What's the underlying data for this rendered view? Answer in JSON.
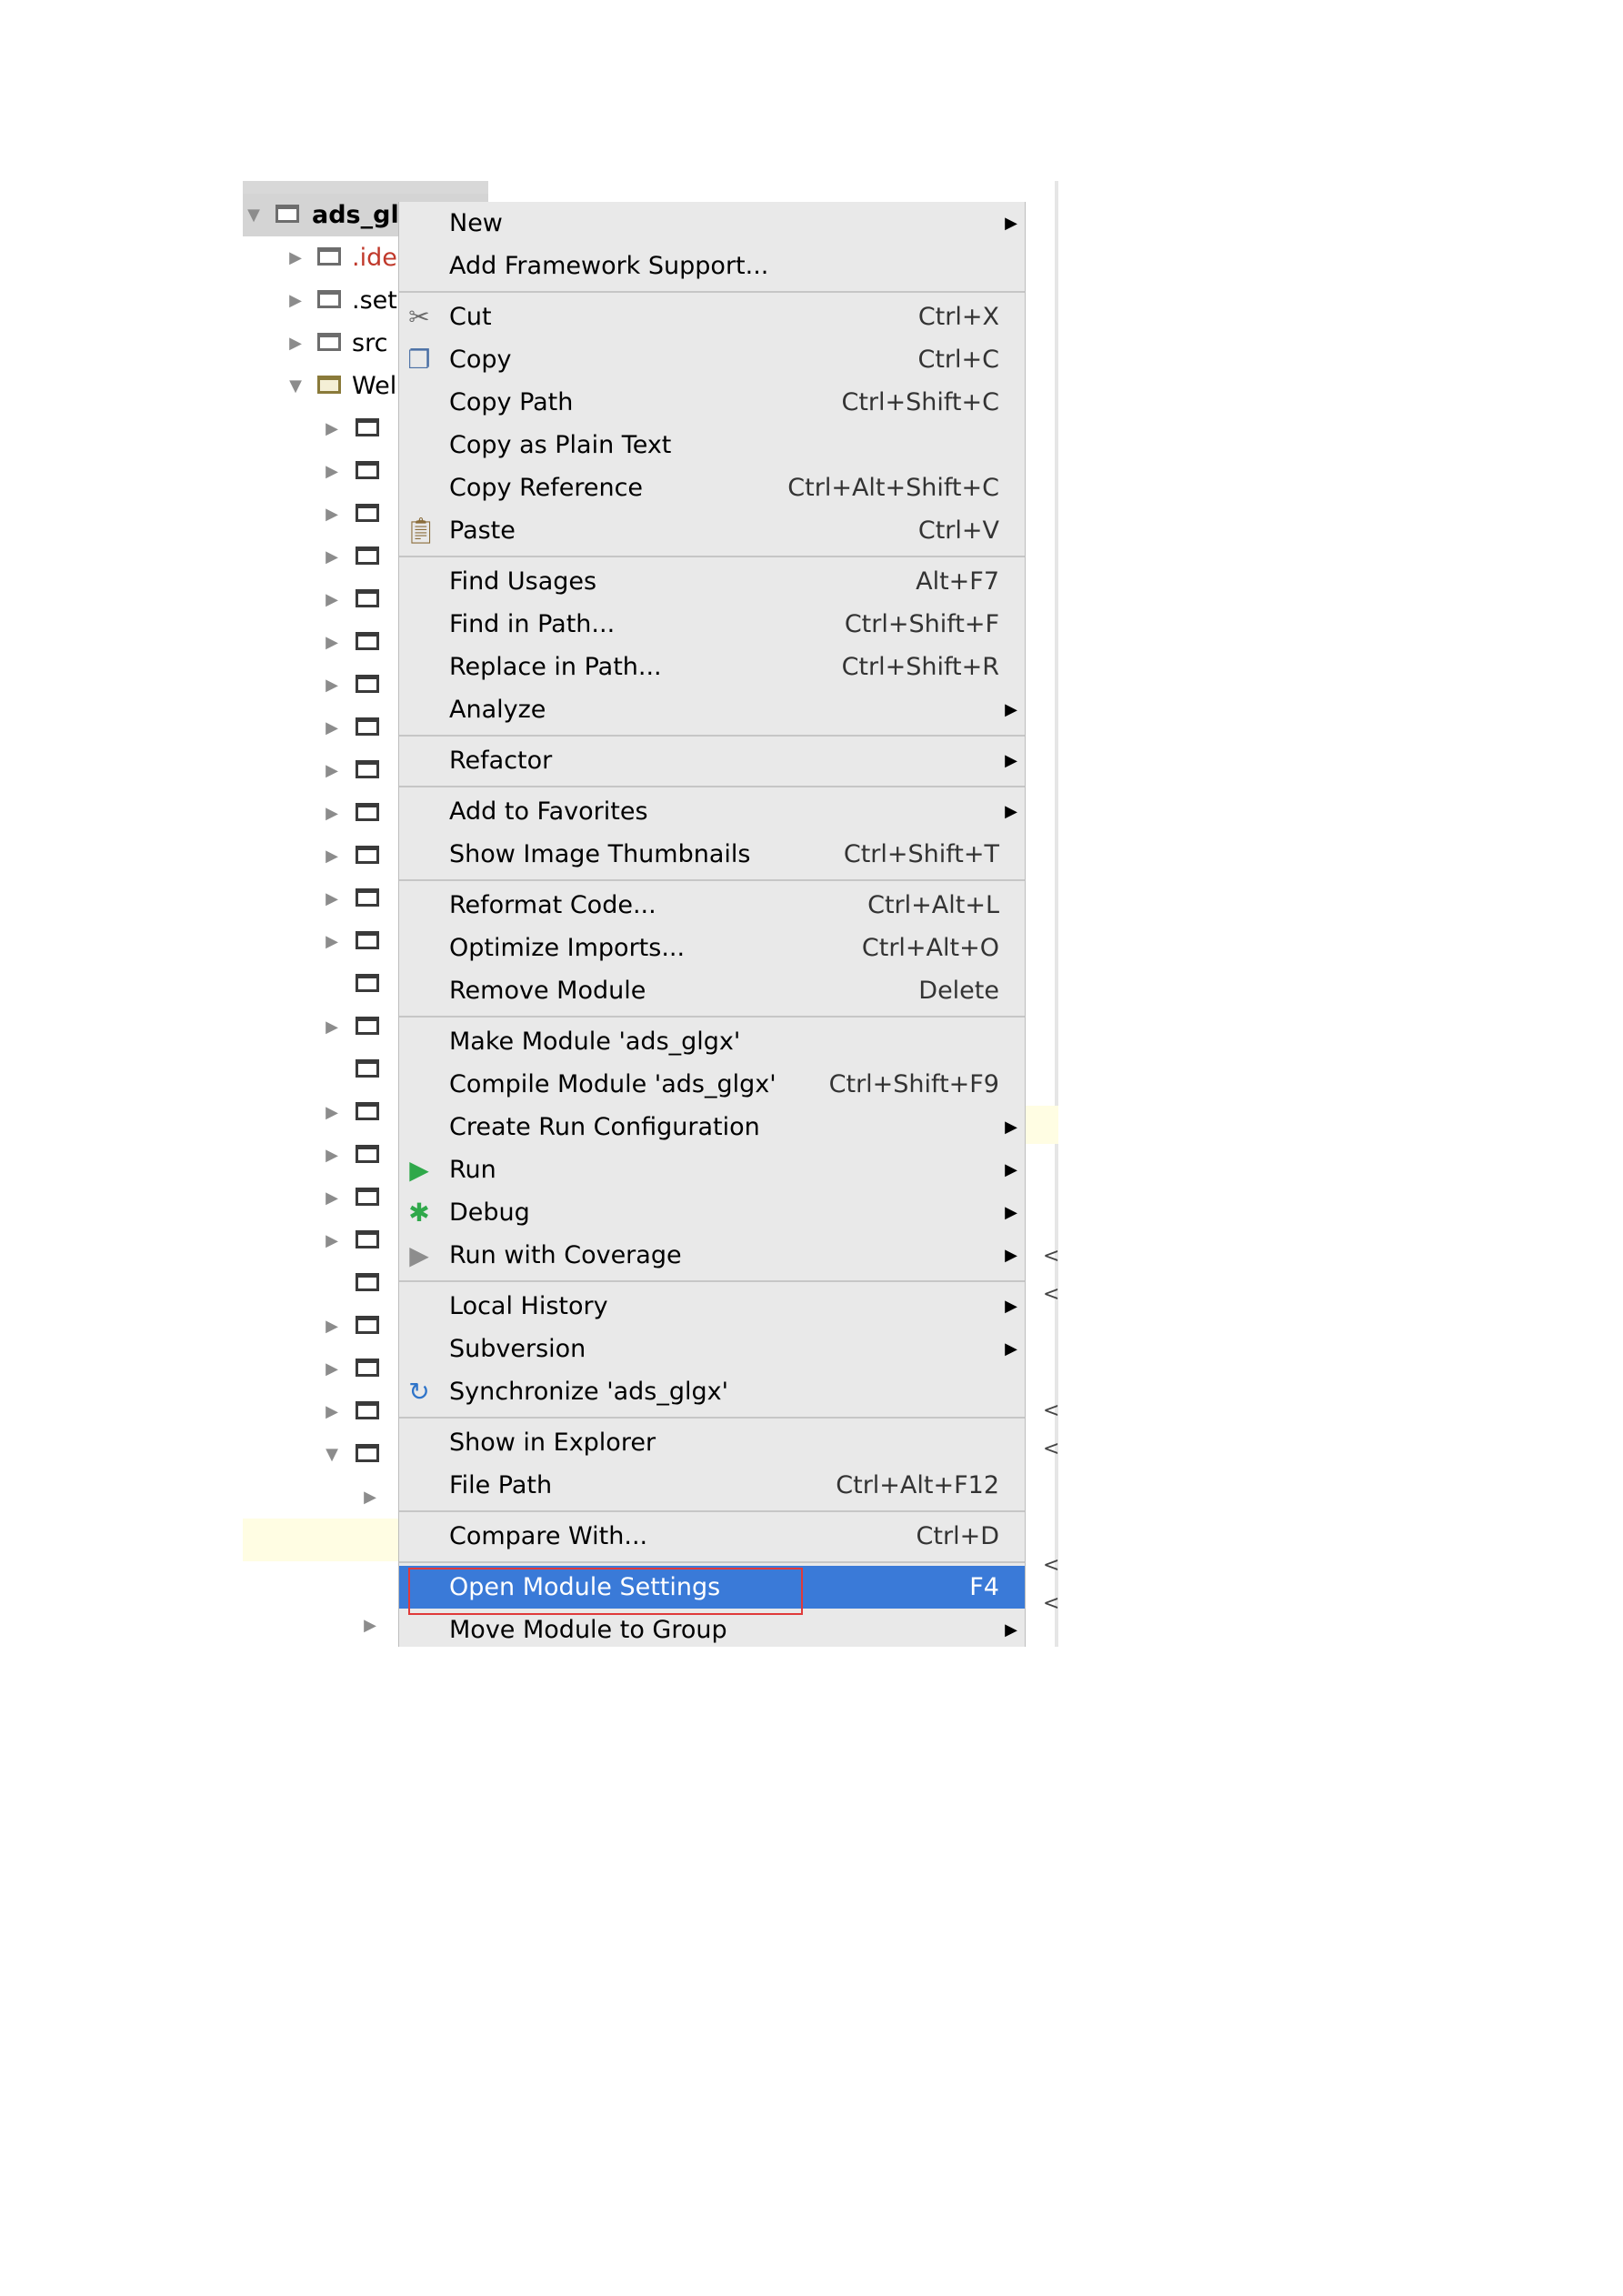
{
  "tree": {
    "root_label": "ads_gl",
    "rows": [
      {
        "label": ".ide",
        "style": "red"
      },
      {
        "label": ".set",
        "style": ""
      },
      {
        "label": "src",
        "style": ""
      },
      {
        "label": "Wel",
        "style": ""
      }
    ]
  },
  "menu": {
    "groups": [
      [
        {
          "label": "New",
          "shortcut": "",
          "submenu": true,
          "icon": ""
        },
        {
          "label": "Add Framework Support...",
          "shortcut": "",
          "submenu": false,
          "icon": ""
        }
      ],
      [
        {
          "label": "Cut",
          "shortcut": "Ctrl+X",
          "submenu": false,
          "icon": "scissors-icon"
        },
        {
          "label": "Copy",
          "shortcut": "Ctrl+C",
          "submenu": false,
          "icon": "copy-icon"
        },
        {
          "label": "Copy Path",
          "shortcut": "Ctrl+Shift+C",
          "submenu": false,
          "icon": ""
        },
        {
          "label": "Copy as Plain Text",
          "shortcut": "",
          "submenu": false,
          "icon": ""
        },
        {
          "label": "Copy Reference",
          "shortcut": "Ctrl+Alt+Shift+C",
          "submenu": false,
          "icon": ""
        },
        {
          "label": "Paste",
          "shortcut": "Ctrl+V",
          "submenu": false,
          "icon": "paste-icon"
        }
      ],
      [
        {
          "label": "Find Usages",
          "shortcut": "Alt+F7",
          "submenu": false,
          "icon": ""
        },
        {
          "label": "Find in Path...",
          "shortcut": "Ctrl+Shift+F",
          "submenu": false,
          "icon": ""
        },
        {
          "label": "Replace in Path...",
          "shortcut": "Ctrl+Shift+R",
          "submenu": false,
          "icon": ""
        },
        {
          "label": "Analyze",
          "shortcut": "",
          "submenu": true,
          "icon": ""
        }
      ],
      [
        {
          "label": "Refactor",
          "shortcut": "",
          "submenu": true,
          "icon": ""
        }
      ],
      [
        {
          "label": "Add to Favorites",
          "shortcut": "",
          "submenu": true,
          "icon": ""
        },
        {
          "label": "Show Image Thumbnails",
          "shortcut": "Ctrl+Shift+T",
          "submenu": false,
          "icon": ""
        }
      ],
      [
        {
          "label": "Reformat Code...",
          "shortcut": "Ctrl+Alt+L",
          "submenu": false,
          "icon": ""
        },
        {
          "label": "Optimize Imports...",
          "shortcut": "Ctrl+Alt+O",
          "submenu": false,
          "icon": ""
        },
        {
          "label": "Remove Module",
          "shortcut": "Delete",
          "submenu": false,
          "icon": ""
        }
      ],
      [
        {
          "label": "Make Module 'ads_glgx'",
          "shortcut": "",
          "submenu": false,
          "icon": ""
        },
        {
          "label": "Compile Module 'ads_glgx'",
          "shortcut": "Ctrl+Shift+F9",
          "submenu": false,
          "icon": ""
        },
        {
          "label": "Create Run Configuration",
          "shortcut": "",
          "submenu": true,
          "icon": ""
        },
        {
          "label": "Run",
          "shortcut": "",
          "submenu": true,
          "icon": "run-icon"
        },
        {
          "label": "Debug",
          "shortcut": "",
          "submenu": true,
          "icon": "debug-icon"
        },
        {
          "label": "Run with Coverage",
          "shortcut": "",
          "submenu": true,
          "icon": "coverage-icon"
        }
      ],
      [
        {
          "label": "Local History",
          "shortcut": "",
          "submenu": true,
          "icon": ""
        },
        {
          "label": "Subversion",
          "shortcut": "",
          "submenu": true,
          "icon": ""
        },
        {
          "label": "Synchronize 'ads_glgx'",
          "shortcut": "",
          "submenu": false,
          "icon": "sync-icon"
        }
      ],
      [
        {
          "label": "Show in Explorer",
          "shortcut": "",
          "submenu": false,
          "icon": ""
        },
        {
          "label": "File Path",
          "shortcut": "Ctrl+Alt+F12",
          "submenu": false,
          "icon": ""
        }
      ],
      [
        {
          "label": "Compare With...",
          "shortcut": "Ctrl+D",
          "submenu": false,
          "icon": ""
        }
      ],
      [
        {
          "label": "Open Module Settings",
          "shortcut": "F4",
          "submenu": false,
          "icon": "",
          "selected": true
        },
        {
          "label": "Move Module to Group",
          "shortcut": "",
          "submenu": true,
          "icon": ""
        }
      ]
    ]
  },
  "colors": {
    "menu_bg": "#e9e9e9",
    "selection": "#3a7ad8",
    "highlight_box": "#e03a3a",
    "row_highlight": "#fffde3"
  }
}
